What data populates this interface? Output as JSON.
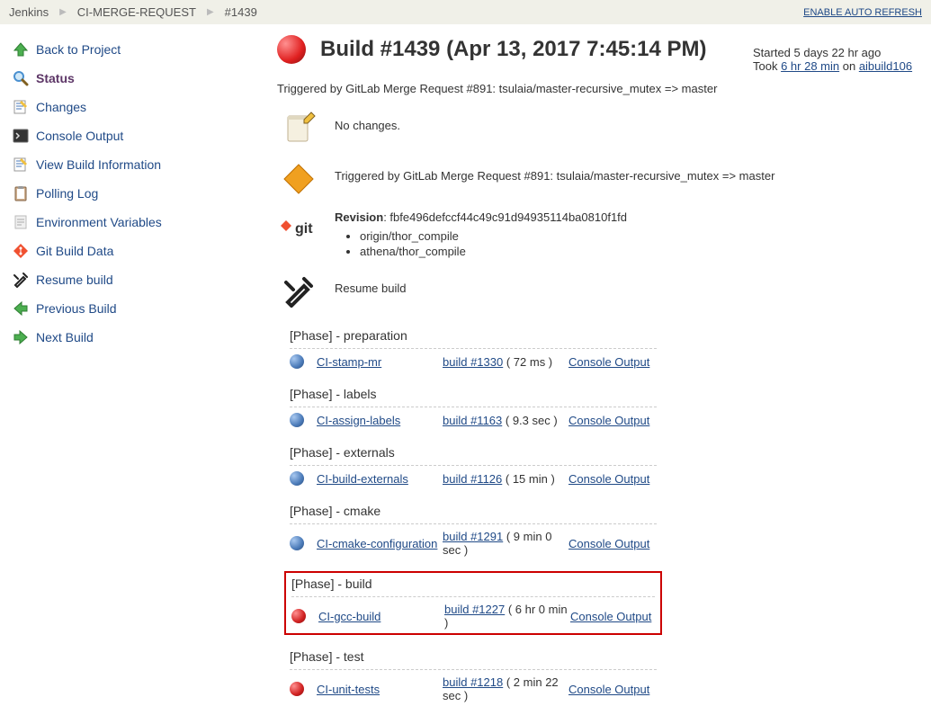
{
  "breadcrumb": {
    "items": [
      "Jenkins",
      "CI-MERGE-REQUEST",
      "#1439"
    ],
    "auto_refresh": "ENABLE AUTO REFRESH"
  },
  "sidebar": {
    "items": [
      {
        "label": "Back to Project",
        "icon": "up-green",
        "active": false
      },
      {
        "label": "Status",
        "icon": "magnifier",
        "active": true
      },
      {
        "label": "Changes",
        "icon": "notes",
        "active": false
      },
      {
        "label": "Console Output",
        "icon": "console",
        "active": false
      },
      {
        "label": "View Build Information",
        "icon": "notes",
        "active": false
      },
      {
        "label": "Polling Log",
        "icon": "clipboard",
        "active": false
      },
      {
        "label": "Environment Variables",
        "icon": "doc",
        "active": false
      },
      {
        "label": "Git Build Data",
        "icon": "git",
        "active": false
      },
      {
        "label": "Resume build",
        "icon": "tools",
        "active": false
      },
      {
        "label": "Previous Build",
        "icon": "left-green",
        "active": false
      },
      {
        "label": "Next Build",
        "icon": "right-green",
        "active": false
      }
    ]
  },
  "build": {
    "title": "Build #1439 (Apr 13, 2017 7:45:14 PM)",
    "started": "Started 5 days 22 hr ago",
    "took_prefix": "Took ",
    "took_link": "6 hr 28 min",
    "took_on": " on ",
    "node": "aibuild106",
    "triggered": "Triggered by GitLab Merge Request #891: tsulaia/master-recursive_mutex => master",
    "no_changes": "No changes.",
    "triggered2": "Triggered by GitLab Merge Request #891: tsulaia/master-recursive_mutex => master",
    "revision_label": "Revision",
    "revision": ": fbfe496defccf44c49c91d94935114ba0810f1fd",
    "branches": [
      "origin/thor_compile",
      "athena/thor_compile"
    ],
    "resume": "Resume build"
  },
  "phases": [
    {
      "title": "[Phase] - preparation",
      "status": "blue",
      "job": "CI-stamp-mr",
      "build": "build #1330",
      "dur": " ( 72 ms )",
      "out": "Console Output",
      "highlighted": false
    },
    {
      "title": "[Phase] - labels",
      "status": "blue",
      "job": "CI-assign-labels",
      "build": "build #1163",
      "dur": " ( 9.3 sec )",
      "out": "Console Output",
      "highlighted": false
    },
    {
      "title": "[Phase] - externals",
      "status": "blue",
      "job": "CI-build-externals",
      "build": "build #1126",
      "dur": " ( 15 min )",
      "out": "Console Output",
      "highlighted": false
    },
    {
      "title": "[Phase] - cmake",
      "status": "blue",
      "job": "CI-cmake-configuration",
      "build": "build #1291",
      "dur": " ( 9 min 0 sec )",
      "out": "Console Output",
      "highlighted": false
    },
    {
      "title": "[Phase] - build",
      "status": "red",
      "job": "CI-gcc-build",
      "build": "build #1227",
      "dur": " ( 6 hr 0 min )",
      "out": "Console Output",
      "highlighted": true
    },
    {
      "title": "[Phase] - test",
      "status": "red",
      "job": "CI-unit-tests",
      "build": "build #1218",
      "dur": " ( 2 min 22 sec )",
      "out": "Console Output",
      "highlighted": false
    }
  ]
}
